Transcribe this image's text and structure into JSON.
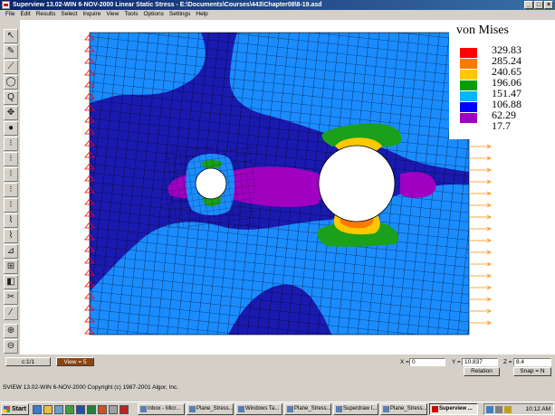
{
  "window": {
    "title": "Superview 13.02-WIN 6-NOV-2000 Linear Static Stress - E:\\Documents\\Courses\\443\\Chapter08\\8-19.asd",
    "buttons": [
      "_",
      "□",
      "×"
    ]
  },
  "menu": [
    "File",
    "Edit",
    "Results",
    "Select",
    "Inquire",
    "View",
    "Tools",
    "Options",
    "Settings",
    "Help"
  ],
  "legend": {
    "title": "von Mises",
    "values": [
      "329.83",
      "285.24",
      "240.65",
      "196.06",
      "151.47",
      "106.88",
      "62.29",
      "17.7"
    ],
    "colors": [
      "#ff0000",
      "#ff7800",
      "#ffc800",
      "#00a000",
      "#00b4ff",
      "#0000ff",
      "#a000c0"
    ]
  },
  "contour_colors": {
    "background": "#1a1ab0",
    "light_blue": "#1a8cff",
    "purple": "#a000c0",
    "green": "#1aa01a",
    "yellow": "#ffc800",
    "orange": "#ff7800",
    "red": "#ff0000",
    "mesh": "#000000",
    "constraint": "#ff0000",
    "load_arrow": "#ff8c00"
  },
  "tabs": {
    "left": "c:1/1",
    "view": "View = 5"
  },
  "coords": {
    "x_label": "X =",
    "x_value": "0",
    "y_label": "Y =",
    "y_value": "10.837",
    "z_label": "Z =",
    "z_value": "8.4"
  },
  "buttons": {
    "relation": "Relation",
    "snap": "Snap = N"
  },
  "status": "SVIEW 13.02-WIN 6-NOV-2000  Copyright (c) 1987-2001 Algor, Inc.",
  "taskbar": {
    "start": "Start",
    "items": [
      "Inbox - Micr...",
      "Plane_Stress...",
      "Windows Ta...",
      "Plane_Stress...",
      "Superdraw I...",
      "Plane_Stress...",
      "Superview ..."
    ],
    "clock": "10:12 AM"
  },
  "toolbar_icons": [
    "select-icon",
    "pencil-icon",
    "measure-icon",
    "circle-icon",
    "zoom-q-icon",
    "pan-icon",
    "sphere-icon",
    "node-1-icon",
    "node-2-icon",
    "node-3-icon",
    "node-4-icon",
    "node-5-icon",
    "mesh-1-icon",
    "mesh-2-icon",
    "probe-icon",
    "grid-icon",
    "fill-icon",
    "cut-icon",
    "paint-icon",
    "zoom-in-icon",
    "zoom-out-icon",
    "zoom-fit-icon"
  ],
  "toolbar_glyphs": [
    "↖",
    "✎",
    "⟋",
    "◯",
    "Q",
    "✥",
    "●",
    "⁝",
    "⁝",
    "⁝",
    "⁝",
    "⁝",
    "⌇",
    "⌇",
    "⊿",
    "⊞",
    "◧",
    "✂",
    "⁄",
    "⊕",
    "⊖",
    "⊙"
  ]
}
